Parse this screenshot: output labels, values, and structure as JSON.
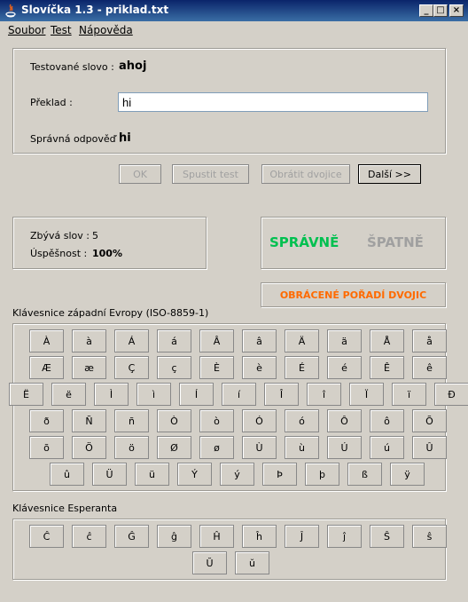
{
  "window": {
    "title": "Slovíčka 1.3 - priklad.txt",
    "minimize": "_",
    "maximize": "□",
    "close": "×"
  },
  "menu": [
    {
      "label": "Soubor"
    },
    {
      "label": "Test"
    },
    {
      "label": "Nápověda"
    }
  ],
  "test": {
    "word_label": "Testované slovo :",
    "word_value": "ahoj",
    "translation_label": "Překlad :",
    "translation_value": "hi",
    "correct_label": "Správná odpověď :",
    "correct_value": "hi"
  },
  "buttons": {
    "ok": "OK",
    "start": "Spustit test",
    "reverse": "Obrátit dvojice",
    "next": "Další >>"
  },
  "stats": {
    "remaining_label": "Zbývá slov :",
    "remaining_value": "5",
    "success_label": "Úspěšnost :",
    "success_value": "100%"
  },
  "result": {
    "correct": "SPRÁVNĚ",
    "wrong": "ŠPATNĚ",
    "correct_color": "#00c050",
    "wrong_color": "#a0a0a0"
  },
  "reversed_order": {
    "label": "OBRÁCENÉ POŘADÍ DVOJIC",
    "color": "#ff6a00"
  },
  "keyboard_west": {
    "title": "Klávesnice západní Evropy (ISO-8859-1)",
    "rows": [
      [
        "À",
        "à",
        "Á",
        "á",
        "Â",
        "â",
        "Ä",
        "ä",
        "Å",
        "å"
      ],
      [
        "Æ",
        "æ",
        "Ç",
        "ç",
        "È",
        "è",
        "É",
        "é",
        "Ê",
        "ê"
      ],
      [
        "Ë",
        "ë",
        "Ì",
        "ì",
        "Í",
        "í",
        "Î",
        "î",
        "Ï",
        "ï",
        "Ð"
      ],
      [
        "ð",
        "Ñ",
        "ñ",
        "Ò",
        "ò",
        "Ó",
        "ó",
        "Ô",
        "ô",
        "Õ"
      ],
      [
        "õ",
        "Ö",
        "ö",
        "Ø",
        "ø",
        "Ù",
        "ù",
        "Ú",
        "ú",
        "Û"
      ],
      [
        "û",
        "Ü",
        "ü",
        "Ý",
        "ý",
        "Þ",
        "þ",
        "ß",
        "ÿ"
      ]
    ]
  },
  "keyboard_esperanto": {
    "title": "Klávesnice Esperanta",
    "rows": [
      [
        "Ĉ",
        "ĉ",
        "Ĝ",
        "ĝ",
        "Ĥ",
        "ĥ",
        "Ĵ",
        "ĵ",
        "Ŝ",
        "ŝ"
      ],
      [
        "Ŭ",
        "ŭ"
      ]
    ]
  }
}
